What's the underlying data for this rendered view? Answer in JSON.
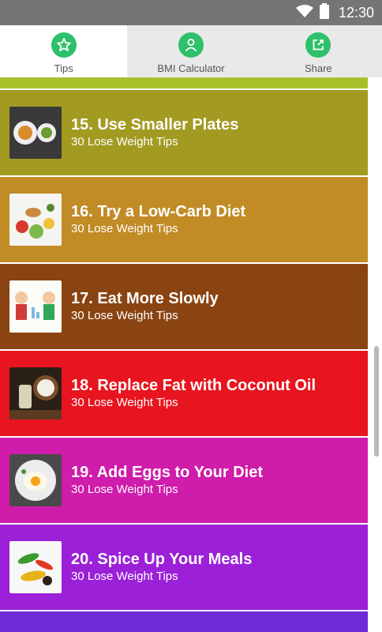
{
  "status_bar": {
    "time": "12:30"
  },
  "tabs": [
    {
      "label": "Tips",
      "icon": "star-icon"
    },
    {
      "label": "BMI Calculator",
      "icon": "person-icon"
    },
    {
      "label": "Share",
      "icon": "share-icon"
    }
  ],
  "list": {
    "items": [
      {
        "title": "15. Use Smaller Plates",
        "subtitle": "30 Lose Weight Tips",
        "color": "#a39a22"
      },
      {
        "title": "16. Try a Low-Carb Diet",
        "subtitle": "30 Lose Weight Tips",
        "color": "#c18b26"
      },
      {
        "title": "17. Eat More Slowly",
        "subtitle": "30 Lose Weight Tips",
        "color": "#8a4412"
      },
      {
        "title": "18. Replace Fat with Coconut Oil",
        "subtitle": "30 Lose Weight Tips",
        "color": "#e8141f"
      },
      {
        "title": "19. Add Eggs to Your Diet",
        "subtitle": "30 Lose Weight Tips",
        "color": "#cf1caa"
      },
      {
        "title": "20. Spice Up Your Meals",
        "subtitle": "30 Lose Weight Tips",
        "color": "#9c20d8"
      }
    ]
  },
  "colors": {
    "accent": "#2ec06a",
    "status_bar": "#757575"
  }
}
